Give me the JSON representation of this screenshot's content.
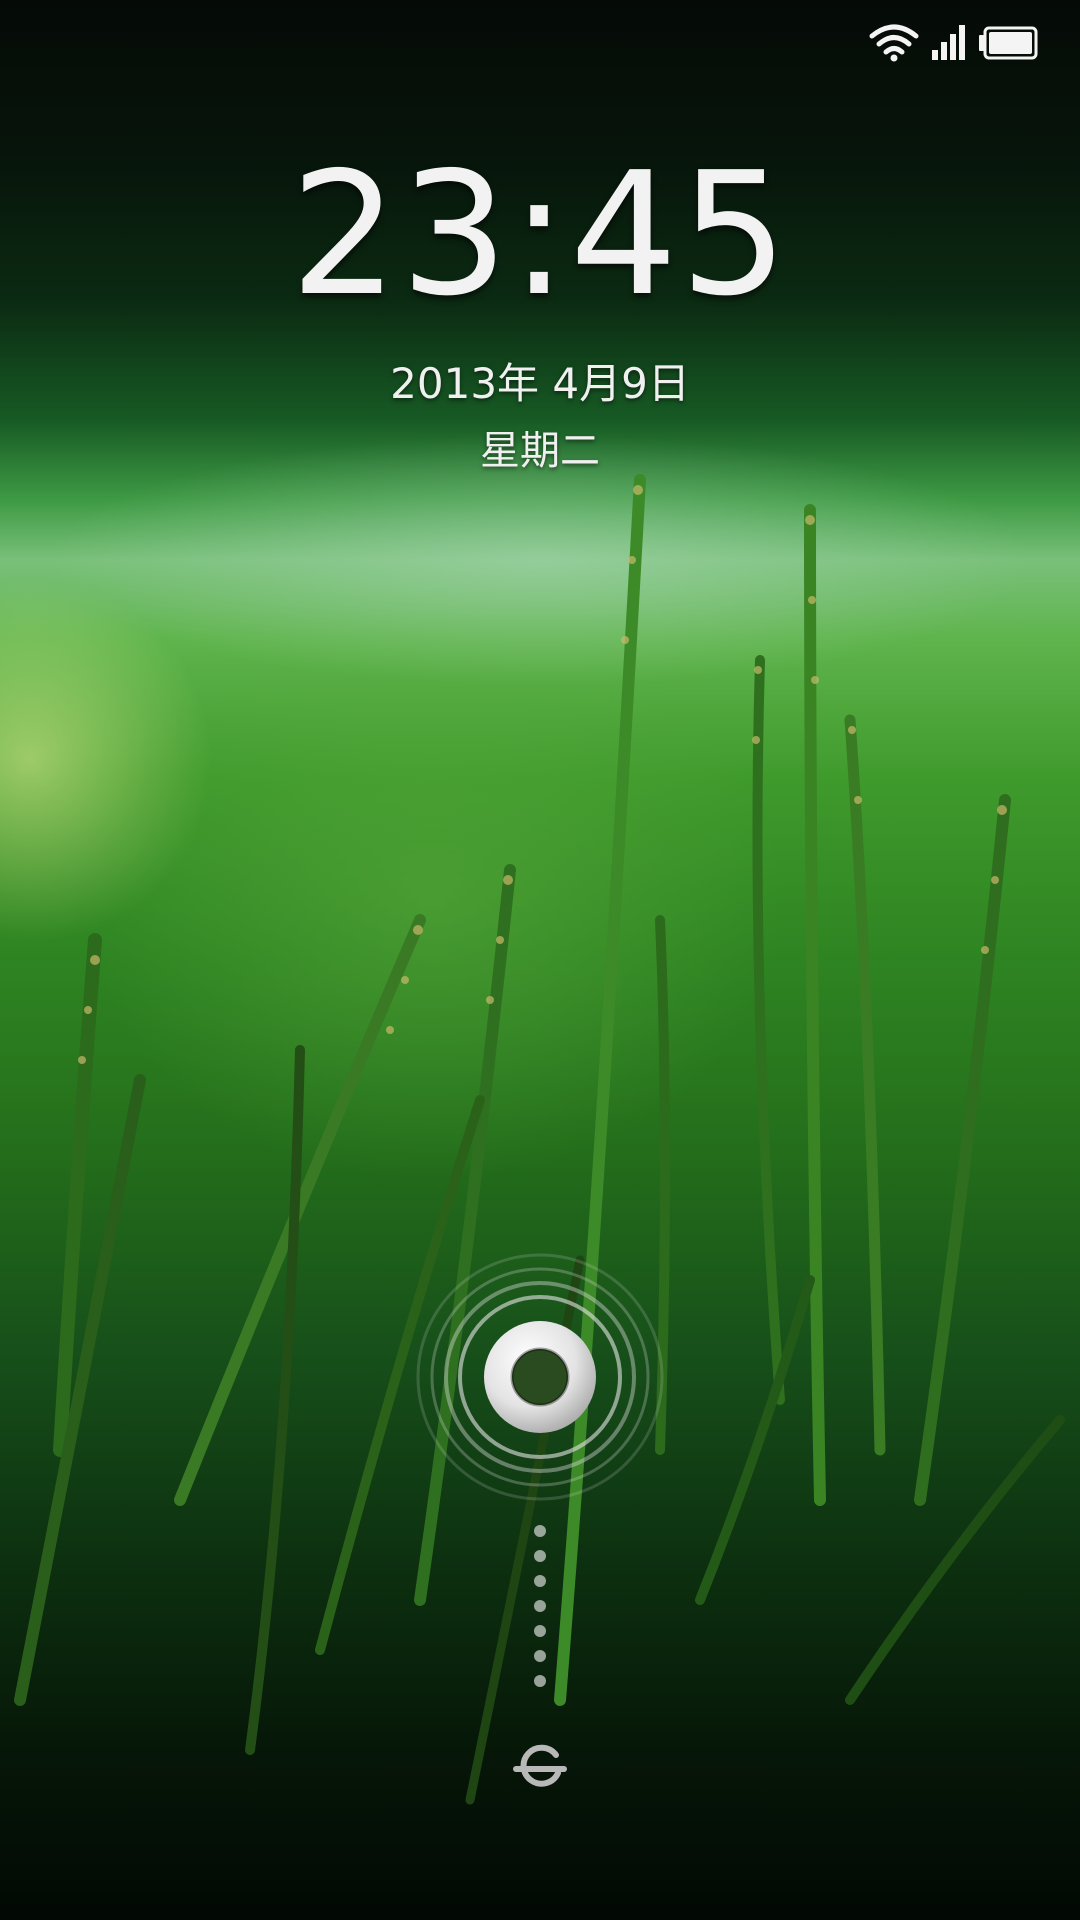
{
  "status_bar": {
    "wifi_icon": "wifi-icon",
    "signal_icon": "cellular-signal-icon",
    "battery_icon": "battery-icon"
  },
  "lockscreen": {
    "time": "23:45",
    "date": "2013年 4月9日",
    "weekday": "星期二"
  },
  "unlock": {
    "handle_icon": "unlock-ring-icon",
    "target_icon": "unlock-target-icon"
  },
  "colors": {
    "text": "#f2f2f2",
    "wallpaper_green": "#3f9a2c",
    "wallpaper_dark": "#050a06"
  }
}
